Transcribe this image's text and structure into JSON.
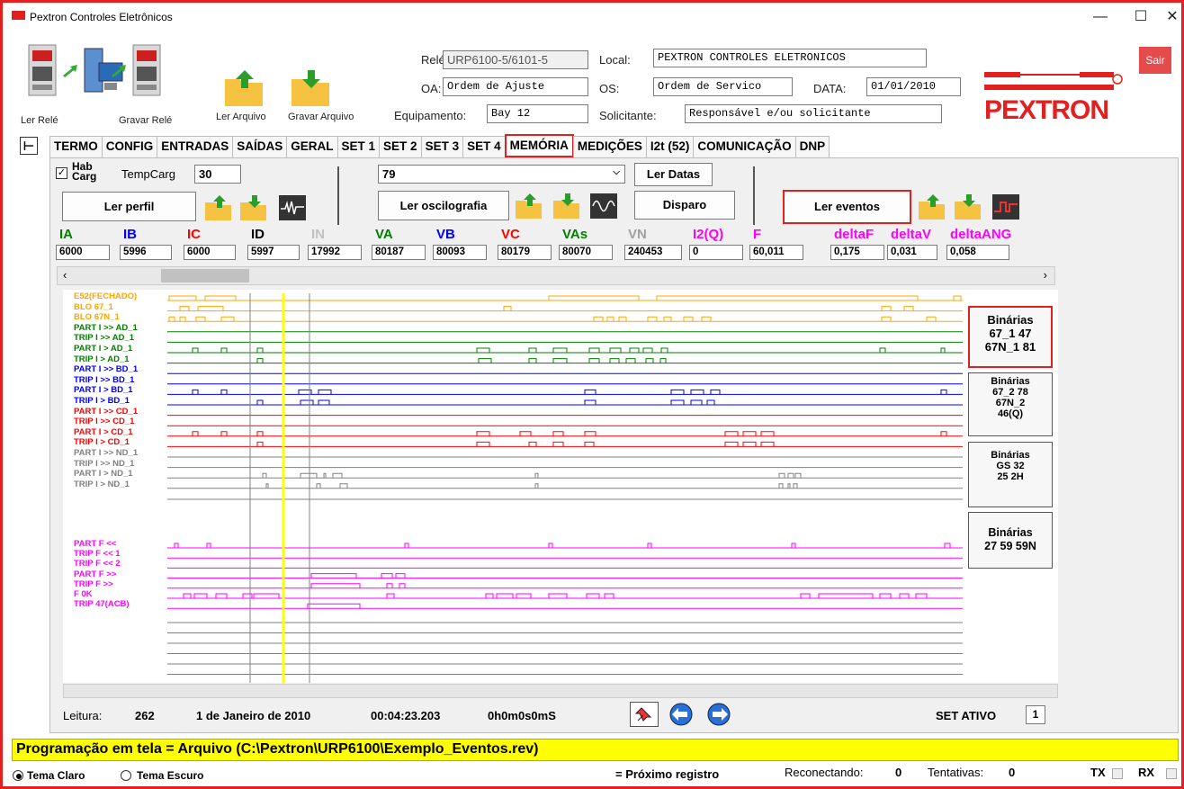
{
  "window": {
    "title": "Pextron Controles Eletrônicos",
    "minimize": "—",
    "maximize": "☐",
    "close": "✕"
  },
  "toolbar": {
    "ler_rele": "Ler Relé",
    "gravar_rele": "Gravar Relé",
    "ler_arquivo": "Ler Arquivo",
    "gravar_arquivo": "Gravar Arquivo"
  },
  "header": {
    "rele_label": "Relé:",
    "rele_value": "URP6100-5/6101-5",
    "oa_label": "OA:",
    "oa_value": "Ordem de Ajuste",
    "equip_label": "Equipamento:",
    "equip_value": "Bay 12",
    "local_label": "Local:",
    "local_value": "PEXTRON CONTROLES ELETRONICOS",
    "os_label": "OS:",
    "os_value": "Ordem de Servico",
    "data_label": "DATA:",
    "data_value": "01/01/2010",
    "solic_label": "Solicitante:",
    "solic_value": "Responsável e/ou solicitante",
    "sair": "Sair",
    "logo": "PEXTRON"
  },
  "tabs": [
    "TERMO",
    "CONFIG",
    "ENTRADAS",
    "SAÍDAS",
    "GERAL",
    "SET 1",
    "SET 2",
    "SET 3",
    "SET 4",
    "MEMÓRIA",
    "MEDIÇÕES",
    "I2t (52)",
    "COMUNICAÇÃO",
    "DNP"
  ],
  "memoria": {
    "hab_carg": "Hab Carg",
    "tempcarg_label": "TempCarg",
    "tempcarg_value": "30",
    "ler_perfil": "Ler perfil",
    "combo_value": "79",
    "ler_datas": "Ler Datas",
    "ler_oscilografia": "Ler oscilografia",
    "disparo": "Disparo",
    "ler_eventos": "Ler eventos"
  },
  "measurements": [
    {
      "label": "IA",
      "value": "6000",
      "color": "#008000"
    },
    {
      "label": "IB",
      "value": "5996",
      "color": "#0000ff"
    },
    {
      "label": "IC",
      "value": "6000",
      "color": "#ff0000"
    },
    {
      "label": "ID",
      "value": "5997",
      "color": "#000000"
    },
    {
      "label": "IN",
      "value": "17992",
      "color": "#c0c0c0"
    },
    {
      "label": "VA",
      "value": "80187",
      "color": "#008000"
    },
    {
      "label": "VB",
      "value": "80093",
      "color": "#0000ff"
    },
    {
      "label": "VC",
      "value": "80179",
      "color": "#ff0000"
    },
    {
      "label": "VAs",
      "value": "80070",
      "color": "#008000"
    },
    {
      "label": "VN",
      "value": "240453",
      "color": "#a0a0a0"
    },
    {
      "label": "I2(Q)",
      "value": "0",
      "color": "#ff00ff"
    },
    {
      "label": "F",
      "value": "60,011",
      "color": "#ff00ff"
    },
    {
      "label": "deltaF",
      "value": "0,175",
      "color": "#ff00ff"
    },
    {
      "label": "deltaV",
      "value": "0,031",
      "color": "#ff00ff"
    },
    {
      "label": "deltaANG",
      "value": "0,058",
      "color": "#ff00ff"
    }
  ],
  "signals": [
    {
      "label": "E52(FECHADO)",
      "color": "#ffa500"
    },
    {
      "label": "BLO 67_1",
      "color": "#ffa500"
    },
    {
      "label": "BLO 67N_1",
      "color": "#ffa500"
    },
    {
      "label": "PART I >> AD_1",
      "color": "#008000"
    },
    {
      "label": "TRIP I >> AD_1",
      "color": "#008000"
    },
    {
      "label": "PART I > AD_1",
      "color": "#008000"
    },
    {
      "label": "TRIP I > AD_1",
      "color": "#008000"
    },
    {
      "label": "PART I >> BD_1",
      "color": "#0000ff"
    },
    {
      "label": "TRIP I >> BD_1",
      "color": "#0000ff"
    },
    {
      "label": "PART I > BD_1",
      "color": "#0000ff"
    },
    {
      "label": "TRIP I > BD_1",
      "color": "#0000ff"
    },
    {
      "label": "PART I >> CD_1",
      "color": "#ff0000"
    },
    {
      "label": "TRIP I >> CD_1",
      "color": "#ff0000"
    },
    {
      "label": "PART I > CD_1",
      "color": "#ff0000"
    },
    {
      "label": "TRIP I > CD_1",
      "color": "#ff0000"
    },
    {
      "label": "PART I >> ND_1",
      "color": "#808080"
    },
    {
      "label": "TRIP I >> ND_1",
      "color": "#808080"
    },
    {
      "label": "PART I > ND_1",
      "color": "#808080"
    },
    {
      "label": "TRIP I > ND_1",
      "color": "#808080"
    },
    {
      "label": "",
      "color": "#808080"
    },
    {
      "label": "PART F <<",
      "color": "#ff00ff"
    },
    {
      "label": "TRIP F << 1",
      "color": "#ff00ff"
    },
    {
      "label": "TRIP F << 2",
      "color": "#ff00ff"
    },
    {
      "label": "PART F >>",
      "color": "#ff00ff"
    },
    {
      "label": "TRIP F >>",
      "color": "#ff00ff"
    },
    {
      "label": "F 0K",
      "color": "#ff00ff"
    },
    {
      "label": "TRIP 47(ACB)",
      "color": "#ff00ff"
    }
  ],
  "binarias": [
    {
      "title": "Binárias",
      "lines": [
        "67_1 47",
        "67N_1 81"
      ]
    },
    {
      "title": "Binárias",
      "lines": [
        "67_2 78",
        "67N_2",
        "46(Q)"
      ]
    },
    {
      "title": "Binárias",
      "lines": [
        "GS 32",
        "25 2H"
      ]
    },
    {
      "title": "Binárias",
      "lines": [
        "27 59 59N"
      ]
    }
  ],
  "status": {
    "leitura_label": "Leitura:",
    "leitura_value": "262",
    "date": "1 de Janeiro de 2010",
    "time": "00:04:23.203",
    "delta": "0h0m0s0mS",
    "set_ativo_label": "SET ATIVO",
    "set_ativo_value": "1"
  },
  "programacao": "Programação em tela = Arquivo (C:\\Pextron\\URP6100\\Exemplo_Eventos.rev)",
  "bottom": {
    "tema_claro": "Tema Claro",
    "tema_escuro": "Tema Escuro",
    "proximo": "= Próximo registro",
    "reconectando_label": "Reconectando:",
    "reconectando_value": "0",
    "tentativas_label": "Tentativas:",
    "tentativas_value": "0",
    "tx": "TX",
    "rx": "RX"
  }
}
